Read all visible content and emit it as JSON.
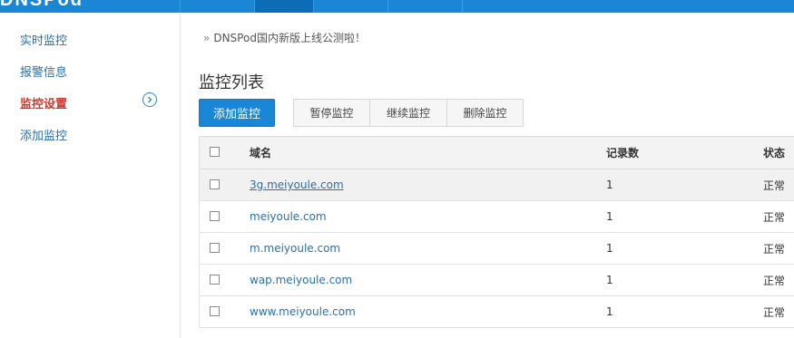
{
  "header": {
    "logo_text": "DNSPod",
    "nav_tabs": [
      "",
      "",
      "",
      ""
    ]
  },
  "sidebar": {
    "items": [
      {
        "label": "实时监控"
      },
      {
        "label": "报警信息"
      },
      {
        "label": "监控设置",
        "active": true
      },
      {
        "label": "添加监控"
      }
    ],
    "arrow_icon": "chevron-right-circle-icon"
  },
  "main": {
    "notice": {
      "prefix": "»",
      "text": "DNSPod国内新版上线公测啦！"
    },
    "title": "监控列表",
    "buttons": {
      "add": "添加监控",
      "pause": "暂停监控",
      "resume": "继续监控",
      "delete": "删除监控"
    },
    "table": {
      "headers": {
        "domain": "域名",
        "count": "记录数",
        "status": "状态"
      },
      "rows": [
        {
          "domain": "3g.meiyoule.com",
          "count": "1",
          "status": "正常"
        },
        {
          "domain": "meiyoule.com",
          "count": "1",
          "status": "正常"
        },
        {
          "domain": "m.meiyoule.com",
          "count": "1",
          "status": "正常"
        },
        {
          "domain": "wap.meiyoule.com",
          "count": "1",
          "status": "正常"
        },
        {
          "domain": "www.meiyoule.com",
          "count": "1",
          "status": "正常"
        }
      ]
    }
  },
  "colors": {
    "brand_blue": "#1a87d6",
    "active_red": "#c8372d",
    "link_blue": "#2a6fa8"
  }
}
